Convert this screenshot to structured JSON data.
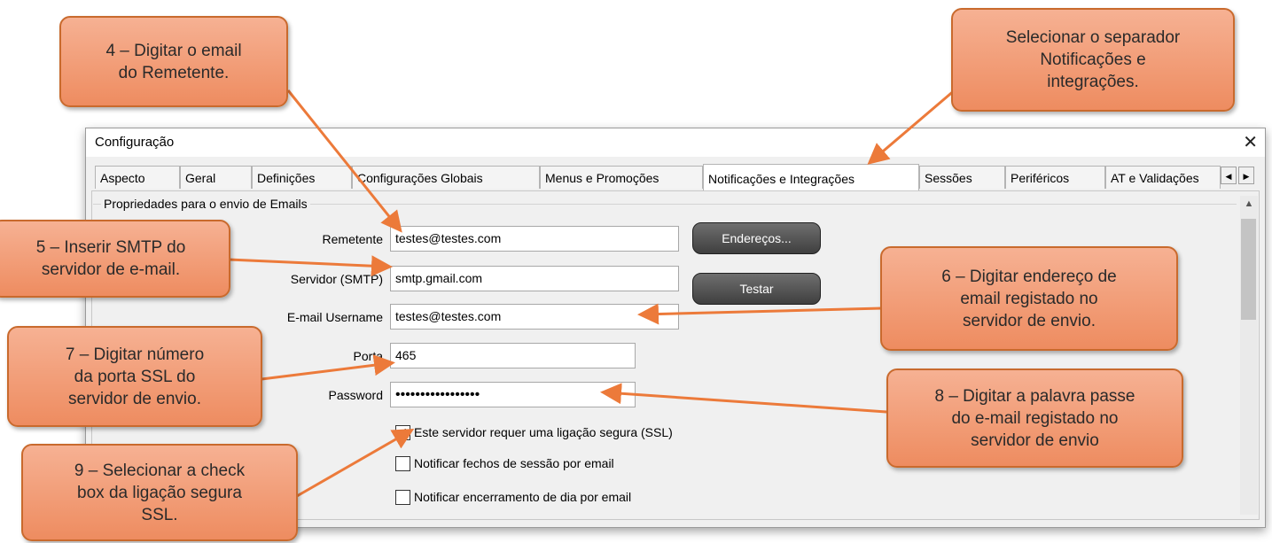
{
  "window": {
    "title": "Configuração"
  },
  "tabs": [
    {
      "label": "Aspecto"
    },
    {
      "label": "Geral"
    },
    {
      "label": "Definições"
    },
    {
      "label": "Configurações Globais"
    },
    {
      "label": "Menus e Promoções"
    },
    {
      "label": "Notificações e Integrações",
      "active": true
    },
    {
      "label": "Sessões"
    },
    {
      "label": "Periféricos"
    },
    {
      "label": "AT e Validações"
    }
  ],
  "group": {
    "title": "Propriedades para o envio de Emails"
  },
  "form": {
    "remetente": {
      "label": "Remetente",
      "value": "testes@testes.com"
    },
    "servidor": {
      "label": "Servidor (SMTP)",
      "value": "smtp.gmail.com"
    },
    "username": {
      "label": "E-mail Username",
      "value": "testes@testes.com"
    },
    "porta": {
      "label": "Porta",
      "value": "465"
    },
    "password": {
      "label": "Password",
      "value": "•••••••••••••••••"
    }
  },
  "buttons": {
    "enderecos": "Endereços...",
    "testar": "Testar"
  },
  "checkboxes": [
    {
      "label": "Este servidor requer uma ligação segura (SSL)",
      "checked": true
    },
    {
      "label": "Notificar fechos de sessão por email",
      "checked": false
    },
    {
      "label": "Notificar encerramento de dia por email",
      "checked": false
    }
  ],
  "callouts": {
    "c4": [
      "4 – Digitar o email",
      "do Remetente."
    ],
    "tab": [
      "Selecionar o separador",
      "Notificações e",
      "integrações."
    ],
    "c5": [
      "5 – Inserir SMTP do",
      "servidor de e-mail."
    ],
    "c6": [
      "6 – Digitar endereço de",
      "email registado no",
      "servidor de envio."
    ],
    "c7": [
      "7 – Digitar número",
      "da porta SSL do",
      "servidor de envio."
    ],
    "c8": [
      "8 – Digitar a palavra passe",
      "do e-mail registado no",
      "servidor de envio"
    ],
    "c9": [
      "9 – Selecionar a check",
      "box da ligação segura",
      "SSL."
    ]
  },
  "colors": {
    "callout_fill": "#f3a07a",
    "callout_border": "#c96a2d",
    "arrow": "#ec7a3a"
  }
}
